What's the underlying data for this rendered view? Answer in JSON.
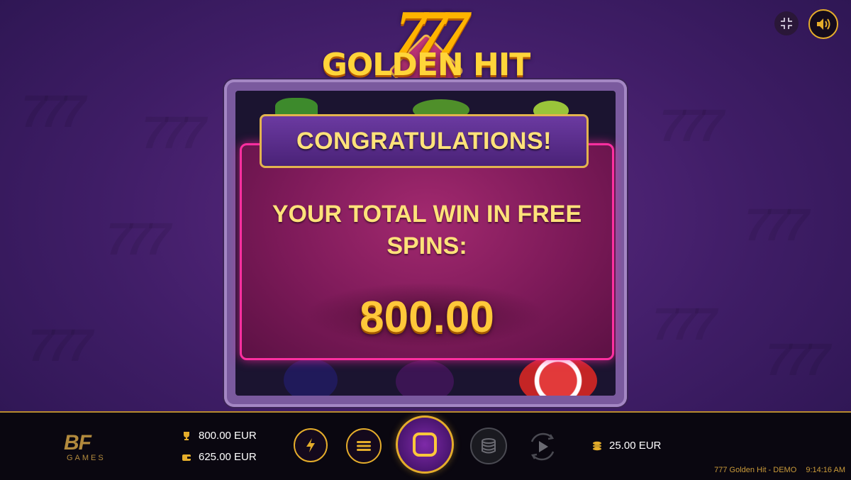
{
  "game": {
    "logo_sevens": "777",
    "logo_title": "GOLDEN HIT"
  },
  "top_controls": {
    "fullscreen_icon": "collapse-icon",
    "sound_icon": "speaker-icon"
  },
  "popup": {
    "heading": "CONGRATULATIONS!",
    "message": "YOUR TOTAL WIN IN FREE SPINS:",
    "amount": "800.00"
  },
  "bottom_bar": {
    "brand": {
      "mark": "BF",
      "sub": "GAMES"
    },
    "win": "800.00 EUR",
    "balance": "625.00 EUR",
    "bet": "25.00 EUR",
    "game_name": "777 Golden Hit - DEMO",
    "time": "9:14:16 AM"
  },
  "colors": {
    "accent_gold": "#e5ad2b",
    "popup_border": "#ff2fa0",
    "text_gold": "#ffe27a"
  }
}
